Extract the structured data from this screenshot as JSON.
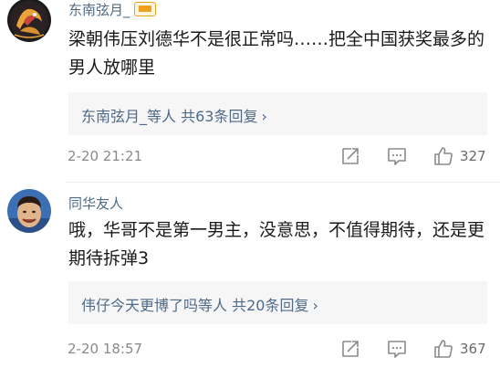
{
  "comments": [
    {
      "username": "东南弦月_",
      "text": "梁朝伟压刘德华不是很正常吗……把全中国获奖最多的男人放哪里",
      "replies_label": "东南弦月_等人 共63条回复",
      "time": "2-20 21:21",
      "likes": "327",
      "vip": true
    },
    {
      "username": "同华友人",
      "text": "哦，华哥不是第一男主，没意思，不值得期待，还是更期待拆弹3",
      "replies_label": "伟仔今天更博了吗等人 共20条回复",
      "time": "2-20 18:57",
      "likes": "367",
      "vip": false
    }
  ],
  "icons": {
    "forward": "forward-icon",
    "comment": "comment-icon",
    "like": "like-icon",
    "chevron": "chevron-right-icon"
  },
  "colors": {
    "username": "#4f6a86",
    "meta": "#8a8a8a",
    "reply_bg": "#f6f6f6"
  }
}
